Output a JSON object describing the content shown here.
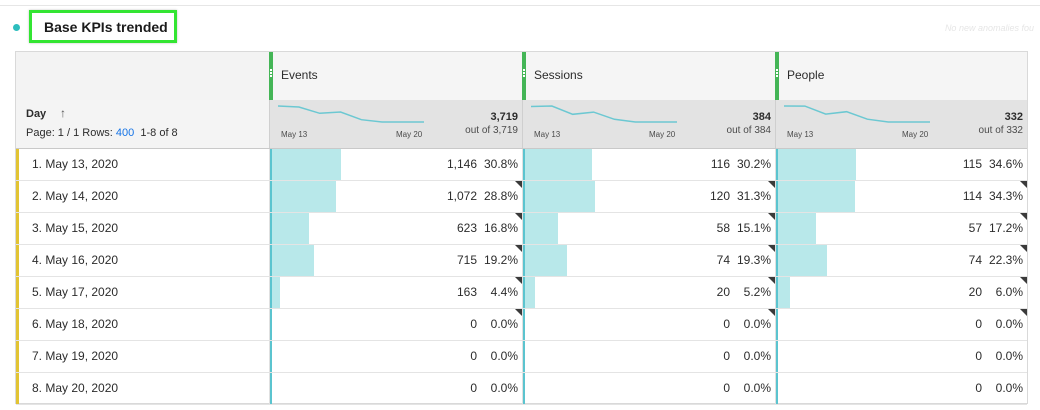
{
  "panel": {
    "title": "Base KPIs trended",
    "faint_text": "No new anomalies fou"
  },
  "dimension": {
    "name": "Day",
    "sort_icon": "arrow-up-icon",
    "page_label": "Page: 1 / 1 Rows:",
    "rows_value": "400",
    "range": "1-8 of 8"
  },
  "colors": {
    "accent_yellow": "#e2c433",
    "metric_green": "#44b556",
    "bar_fill": "#b8e8ea",
    "sparkline": "#6cc8d2",
    "highlight": "#33e532",
    "link_blue": "#1473e6"
  },
  "metrics": [
    {
      "name": "Events",
      "total": "3,719",
      "out_of": "out of 3,719",
      "start_date": "May 13",
      "end_date": "May 20",
      "sparkline": [
        1146,
        1072,
        623,
        715,
        163,
        0,
        0,
        0
      ]
    },
    {
      "name": "Sessions",
      "total": "384",
      "out_of": "out of 384",
      "start_date": "May 13",
      "end_date": "May 20",
      "sparkline": [
        116,
        120,
        58,
        74,
        20,
        0,
        0,
        0
      ]
    },
    {
      "name": "People",
      "total": "332",
      "out_of": "out of 332",
      "start_date": "May 13",
      "end_date": "May 20",
      "sparkline": [
        115,
        114,
        57,
        74,
        20,
        0,
        0,
        0
      ]
    }
  ],
  "rows": [
    {
      "label": "1. May 13, 2020",
      "cells": [
        {
          "value": "1,146",
          "pct": "30.8%",
          "share": 0.308
        },
        {
          "value": "116",
          "pct": "30.2%",
          "share": 0.302
        },
        {
          "value": "115",
          "pct": "34.6%",
          "share": 0.346
        }
      ]
    },
    {
      "label": "2. May 14, 2020",
      "cells": [
        {
          "value": "1,072",
          "pct": "28.8%",
          "share": 0.288
        },
        {
          "value": "120",
          "pct": "31.3%",
          "share": 0.313
        },
        {
          "value": "114",
          "pct": "34.3%",
          "share": 0.343
        }
      ]
    },
    {
      "label": "3. May 15, 2020",
      "cells": [
        {
          "value": "623",
          "pct": "16.8%",
          "share": 0.168
        },
        {
          "value": "58",
          "pct": "15.1%",
          "share": 0.151
        },
        {
          "value": "57",
          "pct": "17.2%",
          "share": 0.172
        }
      ]
    },
    {
      "label": "4. May 16, 2020",
      "cells": [
        {
          "value": "715",
          "pct": "19.2%",
          "share": 0.192
        },
        {
          "value": "74",
          "pct": "19.3%",
          "share": 0.193
        },
        {
          "value": "74",
          "pct": "22.3%",
          "share": 0.223
        }
      ]
    },
    {
      "label": "5. May 17, 2020",
      "cells": [
        {
          "value": "163",
          "pct": "4.4%",
          "share": 0.044
        },
        {
          "value": "20",
          "pct": "5.2%",
          "share": 0.052
        },
        {
          "value": "20",
          "pct": "6.0%",
          "share": 0.06
        }
      ]
    },
    {
      "label": "6. May 18, 2020",
      "cells": [
        {
          "value": "0",
          "pct": "0.0%",
          "share": 0
        },
        {
          "value": "0",
          "pct": "0.0%",
          "share": 0
        },
        {
          "value": "0",
          "pct": "0.0%",
          "share": 0
        }
      ]
    },
    {
      "label": "7. May 19, 2020",
      "cells": [
        {
          "value": "0",
          "pct": "0.0%",
          "share": 0
        },
        {
          "value": "0",
          "pct": "0.0%",
          "share": 0
        },
        {
          "value": "0",
          "pct": "0.0%",
          "share": 0
        }
      ]
    },
    {
      "label": "8. May 20, 2020",
      "cells": [
        {
          "value": "0",
          "pct": "0.0%",
          "share": 0
        },
        {
          "value": "0",
          "pct": "0.0%",
          "share": 0
        },
        {
          "value": "0",
          "pct": "0.0%",
          "share": 0
        }
      ]
    }
  ]
}
